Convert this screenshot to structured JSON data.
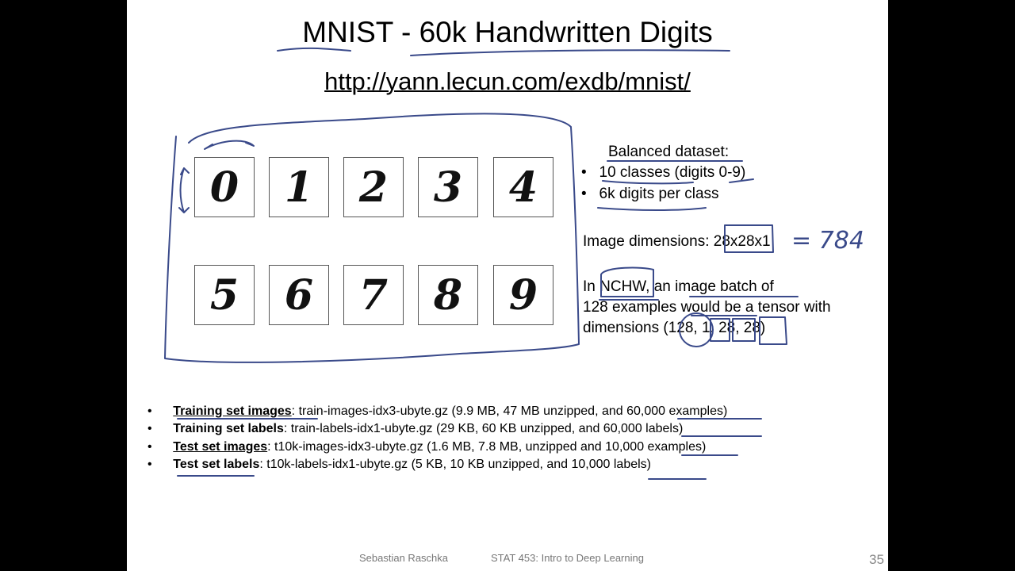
{
  "slide": {
    "title": "MNIST - 60k Handwritten Digits",
    "url": "http://yann.lecun.com/exdb/mnist/",
    "digits": [
      "0",
      "1",
      "2",
      "3",
      "4",
      "5",
      "6",
      "7",
      "8",
      "9"
    ],
    "balanced": {
      "heading": "Balanced dataset:",
      "bullets": [
        "10 classes (digits 0-9)",
        "6k digits per class"
      ]
    },
    "dimensions": {
      "label": "Image dimensions: ",
      "value": "28x28x1",
      "annotation": "= 784"
    },
    "nchw": {
      "line1": "In NCHW, an image batch of",
      "line2": "128 examples would be a tensor with",
      "line3": "dimensions (128, 1, 28, 28)"
    },
    "files": [
      {
        "name": "Training set images",
        "desc": ": train-images-idx3-ubyte.gz (9.9 MB, 47 MB unzipped, and 60,000 examples)"
      },
      {
        "name": "Training set labels",
        "desc": ": train-labels-idx1-ubyte.gz (29 KB, 60 KB unzipped, and 60,000 labels)"
      },
      {
        "name": "Test set images",
        "desc": ": t10k-images-idx3-ubyte.gz (1.6 MB, 7.8 MB, unzipped and 10,000 examples)"
      },
      {
        "name": "Test set labels",
        "desc": ": t10k-labels-idx1-ubyte.gz (5 KB, 10 KB unzipped, and 10,000 labels)"
      }
    ],
    "footer": {
      "author": "Sebastian Raschka",
      "course": "STAT 453: Intro to Deep Learning",
      "page": "35"
    }
  }
}
